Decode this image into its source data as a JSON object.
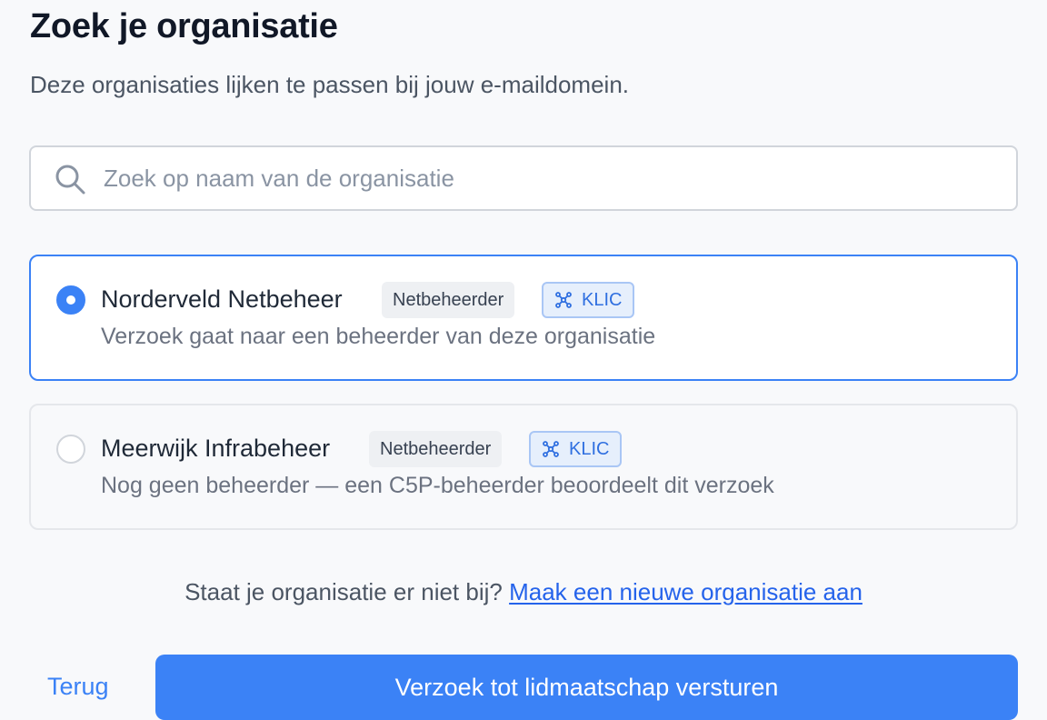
{
  "page": {
    "title": "Zoek je organisatie",
    "subtitle": "Deze organisaties lijken te passen bij jouw e-maildomein."
  },
  "search": {
    "placeholder": "Zoek op naam van de organisatie",
    "value": "",
    "icon": "search-icon"
  },
  "organizations": [
    {
      "name": "Norderveld Netbeheer",
      "type_badge": "Netbeheerder",
      "service_badge": "KLIC",
      "service_icon": "network-icon",
      "description": "Verzoek gaat naar een beheerder van deze organisatie",
      "selected": true
    },
    {
      "name": "Meerwijk Infrabeheer",
      "type_badge": "Netbeheerder",
      "service_badge": "KLIC",
      "service_icon": "network-icon",
      "description": "Nog geen beheerder — een C5P-beheerder beoordeelt dit verzoek",
      "selected": false
    }
  ],
  "footer": {
    "prompt": "Staat je organisatie er niet bij?",
    "create_link": "Maak een nieuwe organisatie aan"
  },
  "actions": {
    "back_label": "Terug",
    "submit_label": "Verzoek tot lidmaatschap versturen"
  },
  "colors": {
    "accent": "#3b82f6",
    "link": "#2563eb",
    "badge_blue_bg": "#e6effc"
  }
}
